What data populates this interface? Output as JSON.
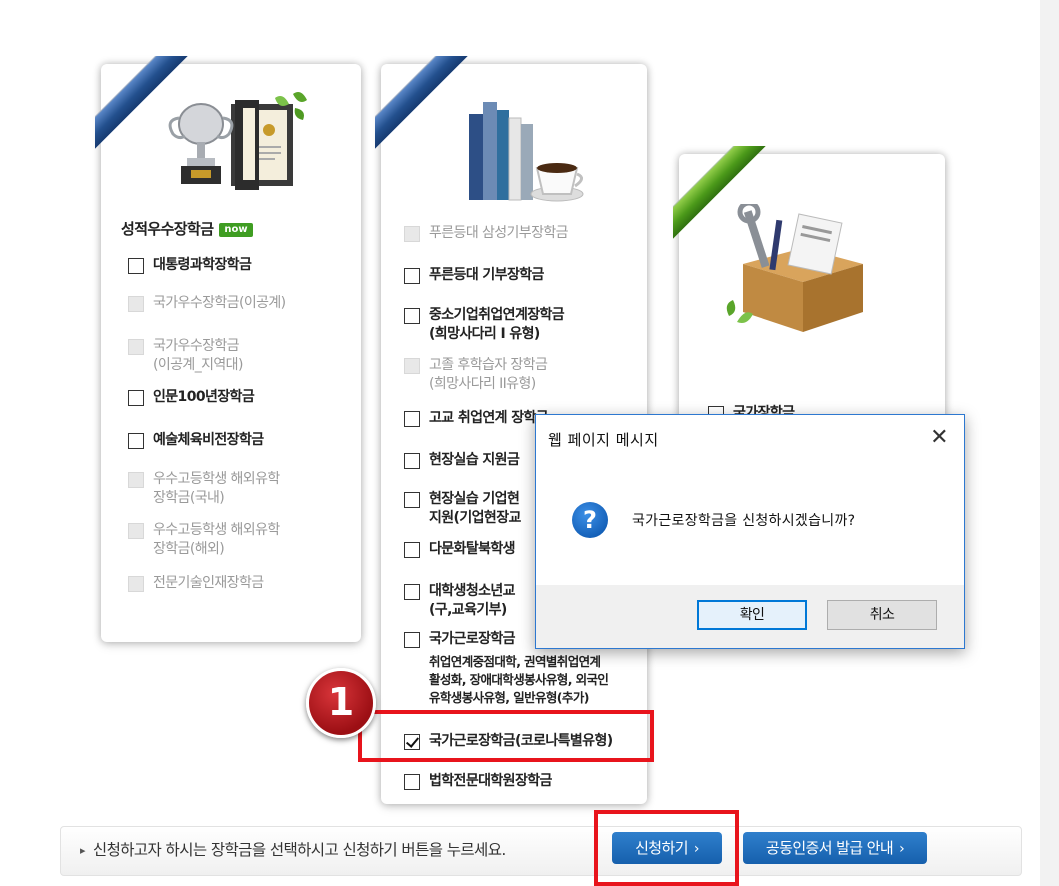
{
  "colors": {
    "accent_blue": "#1660ad",
    "highlight_red": "#e8141c",
    "badge_green": "#3f9d22"
  },
  "card1": {
    "title": "성적우수장학금",
    "badge": "now",
    "items": [
      {
        "label": "대통령과학장학금",
        "enabled": true
      },
      {
        "label": "국가우수장학금(이공계)",
        "enabled": false
      },
      {
        "label": "국가우수장학금\n(이공계_지역대)",
        "enabled": false
      },
      {
        "label": "인문100년장학금",
        "enabled": true
      },
      {
        "label": "예술체육비전장학금",
        "enabled": true
      },
      {
        "label": "우수고등학생 해외유학\n장학금(국내)",
        "enabled": false
      },
      {
        "label": "우수고등학생 해외유학\n장학금(해외)",
        "enabled": false
      },
      {
        "label": "전문기술인재장학금",
        "enabled": false
      }
    ]
  },
  "card2": {
    "items": [
      {
        "label": "푸른등대 삼성기부장학금",
        "enabled": false
      },
      {
        "label": "푸른등대 기부장학금",
        "enabled": true
      },
      {
        "label": "중소기업취업연계장학금\n(희망사다리 I 유형)",
        "enabled": true
      },
      {
        "label": "고졸 후학습자 장학금\n(희망사다리 II유형)",
        "enabled": false
      },
      {
        "label": "고교 취업연계 장학금",
        "enabled": true
      },
      {
        "label": "현장실습 지원금",
        "enabled": true
      },
      {
        "label": "현장실습 기업현\n지원(기업현장교",
        "enabled": true
      },
      {
        "label": "다문화탈북학생",
        "enabled": true
      },
      {
        "label": "대학생청소년교\n(구,교육기부)",
        "enabled": true
      },
      {
        "label": "국가근로장학금",
        "enabled": true
      },
      {
        "label": "국가근로장학금(코로나특별유형)",
        "enabled": true,
        "checked": true
      },
      {
        "label": "법학전문대학원장학금",
        "enabled": true
      }
    ],
    "work_subtext": "취업연계중점대학, 권역별취업연계\n활성화, 장애대학생봉사유형, 외국인\n유학생봉사유형, 일반유형(추가)"
  },
  "card3": {
    "items": [
      {
        "label": "국가장학금",
        "enabled": true
      }
    ]
  },
  "step_number": "1",
  "notice": {
    "bullet": "▸",
    "text": "신청하고자 하시는 장학금을 선택하시고 신청하기 버튼을 누르세요."
  },
  "buttons": {
    "apply": "신청하기",
    "cert_guide": "공동인증서 발급 안내",
    "chevron": "›"
  },
  "dialog": {
    "title": "웹 페이지 메시지",
    "close": "✕",
    "icon": "?",
    "message": "국가근로장학금을 신청하시겠습니까?",
    "ok": "확인",
    "cancel": "취소"
  }
}
